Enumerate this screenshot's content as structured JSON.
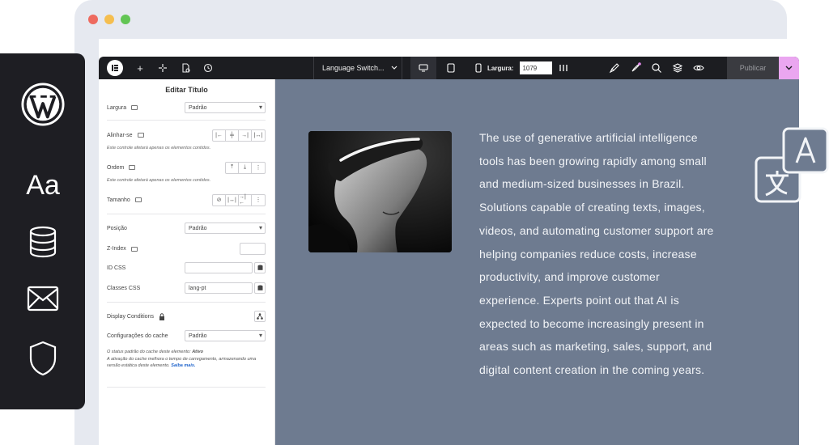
{
  "wp_sidebar": {
    "icons": [
      "wordpress-icon",
      "typography-icon",
      "database-icon",
      "mail-icon",
      "shield-icon"
    ],
    "typography_label": "Aa"
  },
  "topbar": {
    "language_switcher": "Language Switch...",
    "width_label": "Largura:",
    "width_value": "1079",
    "publish_label": "Publicar"
  },
  "panel": {
    "title": "Editar Título",
    "largura_label": "Largura",
    "largura_value": "Padrão",
    "alinhar_label": "Alinhar-se",
    "alinhar_note": "Este controle afetará apenas os elementos contidos.",
    "ordem_label": "Ordem",
    "ordem_note": "Este controle afetará apenas os elementos contidos.",
    "tamanho_label": "Tamanho",
    "posicao_label": "Posição",
    "posicao_value": "Padrão",
    "zindex_label": "Z-Index",
    "idcss_label": "ID CSS",
    "idcss_value": "",
    "classes_label": "Classes CSS",
    "classes_value": "lang-pt",
    "display_label": "Display Conditions",
    "cache_label": "Configurações do cache",
    "cache_value": "Padrão",
    "cache_note_1": "O status padrão do cache deste elemento: ",
    "cache_note_status": "Ativo",
    "cache_note_2": "A ativação do cache melhora o tempo de carregamento, armazenando uma versão estática deste elemento. ",
    "cache_note_link": "Saiba mais."
  },
  "canvas": {
    "article_text": "The use of generative artificial intelligence tools has been growing rapidly among small and medium-sized businesses in Brazil. Solutions capable of creating texts, images, videos, and automating customer support are helping companies reduce costs, increase productivity, and improve customer experience. Experts point out that AI is expected to become increasingly present in areas such as marketing, sales, support, and digital content creation in the coming years."
  },
  "colors": {
    "canvas_bg": "#6e7b90",
    "topbar_bg": "#1c1d21",
    "accent_pink": "#eaa6f0",
    "sidebar_bg": "#1e1e23"
  }
}
